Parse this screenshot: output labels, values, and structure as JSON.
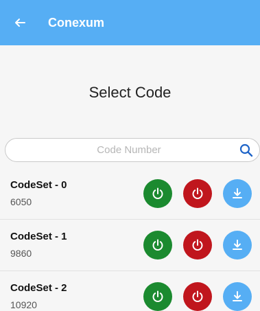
{
  "appbar": {
    "title": "Conexum",
    "color": "#56aef4"
  },
  "page": {
    "title": "Select Code"
  },
  "search": {
    "placeholder": "Code Number"
  },
  "colors": {
    "power_on": "#1b8a2f",
    "power_off": "#c0161d",
    "download": "#56aef4"
  },
  "codesets": [
    {
      "name": "CodeSet - 0",
      "code": "6050"
    },
    {
      "name": "CodeSet - 1",
      "code": "9860"
    },
    {
      "name": "CodeSet - 2",
      "code": "10920"
    }
  ],
  "icons": {
    "back": "arrow-left-icon",
    "search": "search-icon",
    "on": "power-icon",
    "off": "power-icon",
    "download": "download-icon"
  }
}
